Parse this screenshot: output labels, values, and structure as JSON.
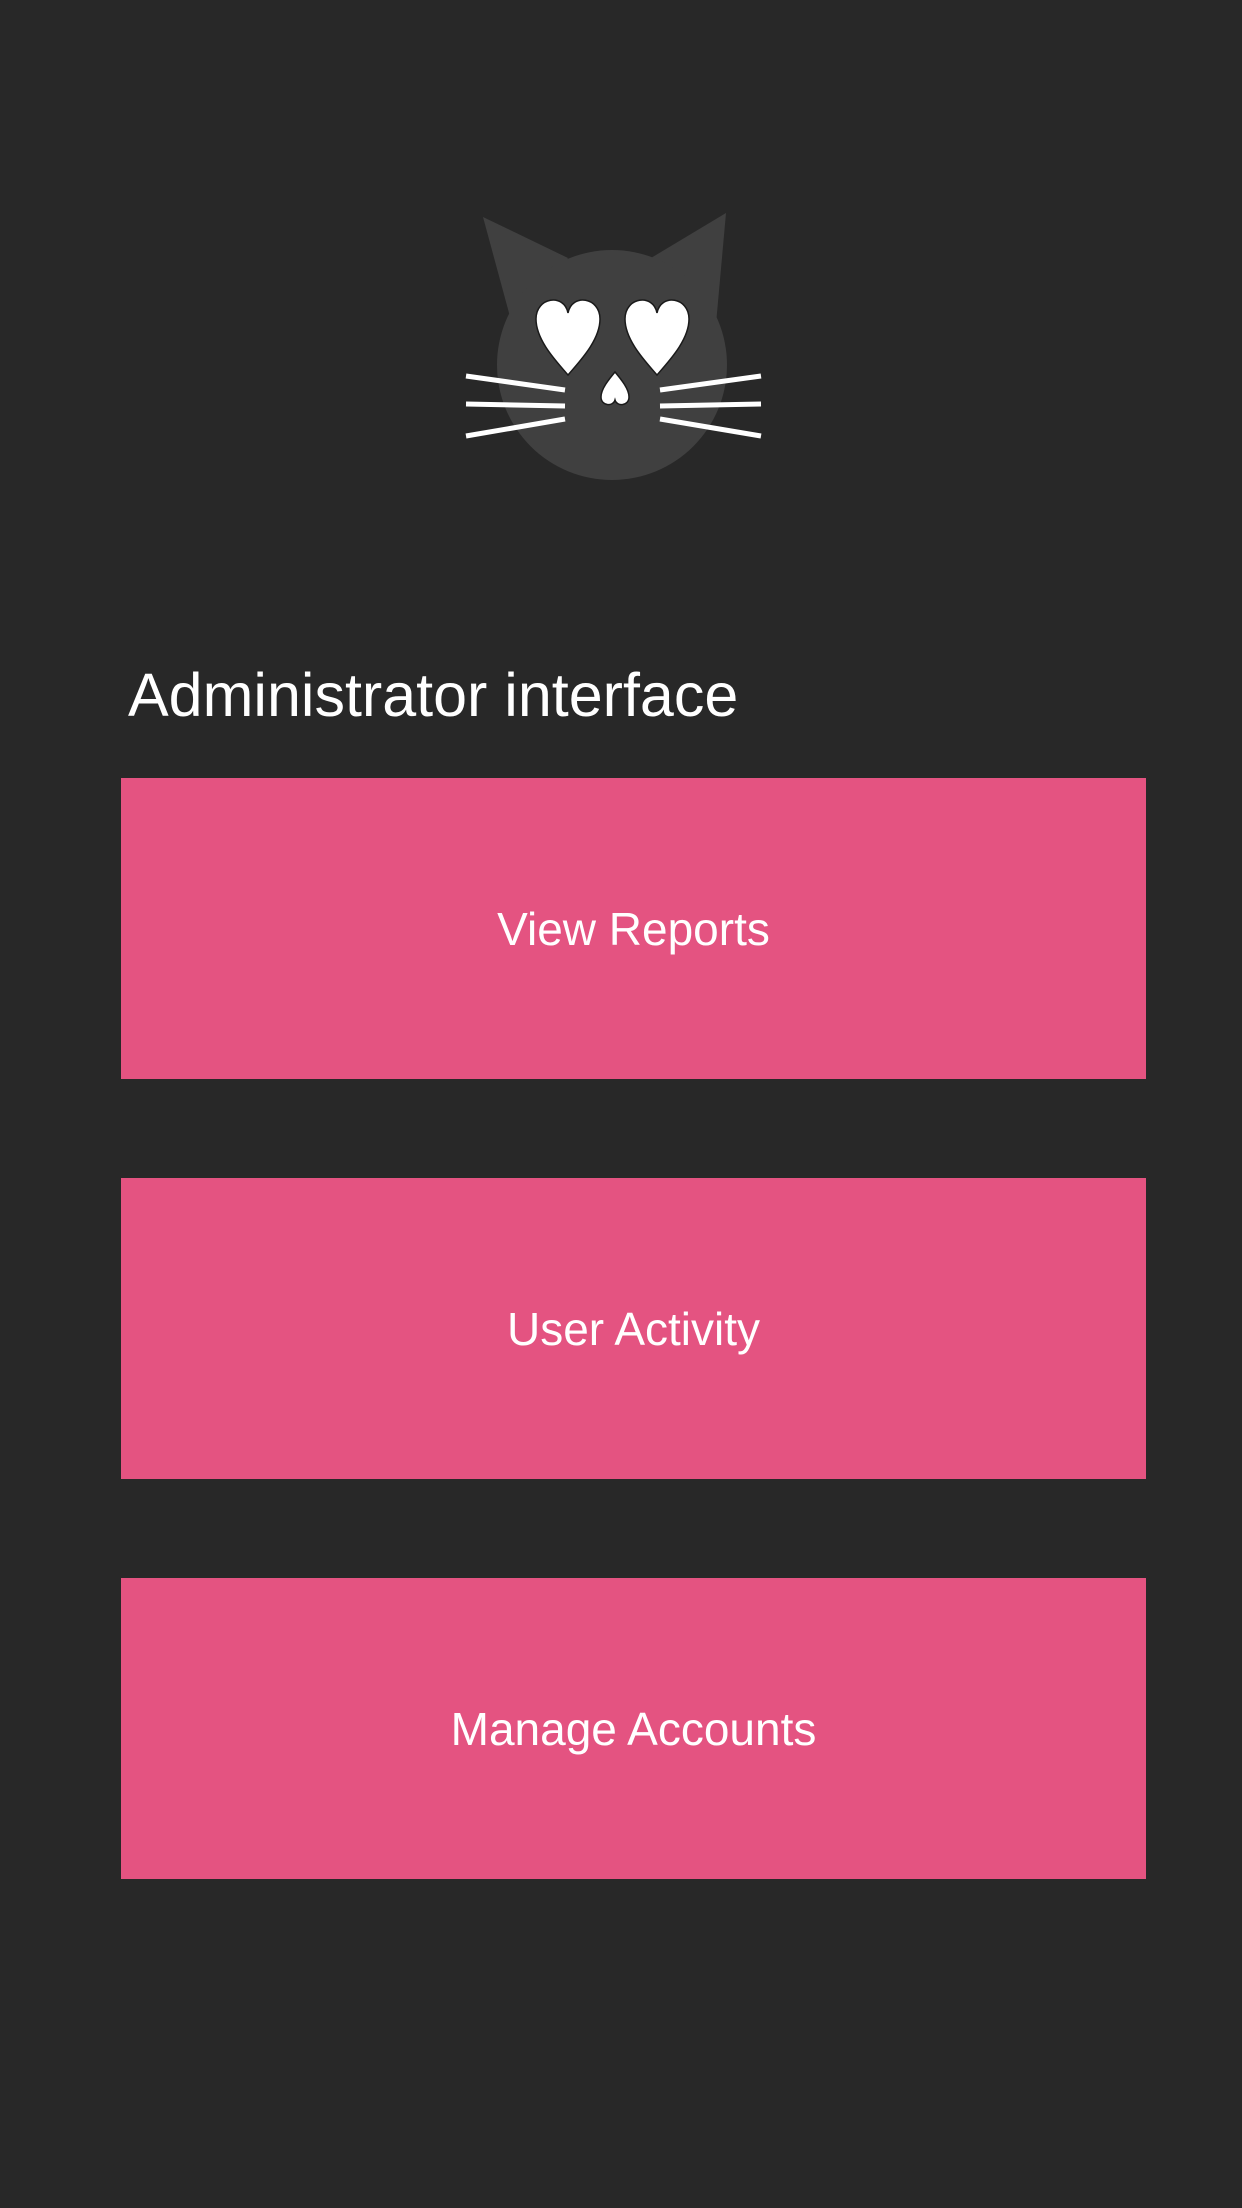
{
  "app": {
    "logo_icon": "cat-heart-eyes-icon",
    "title": "Administrator interface"
  },
  "menu": {
    "items": [
      {
        "label": "View Reports"
      },
      {
        "label": "User Activity"
      },
      {
        "label": "Manage Accounts"
      }
    ]
  },
  "colors": {
    "background": "#282828",
    "cat_head": "#404040",
    "button": "#e45381",
    "text": "#ffffff"
  }
}
